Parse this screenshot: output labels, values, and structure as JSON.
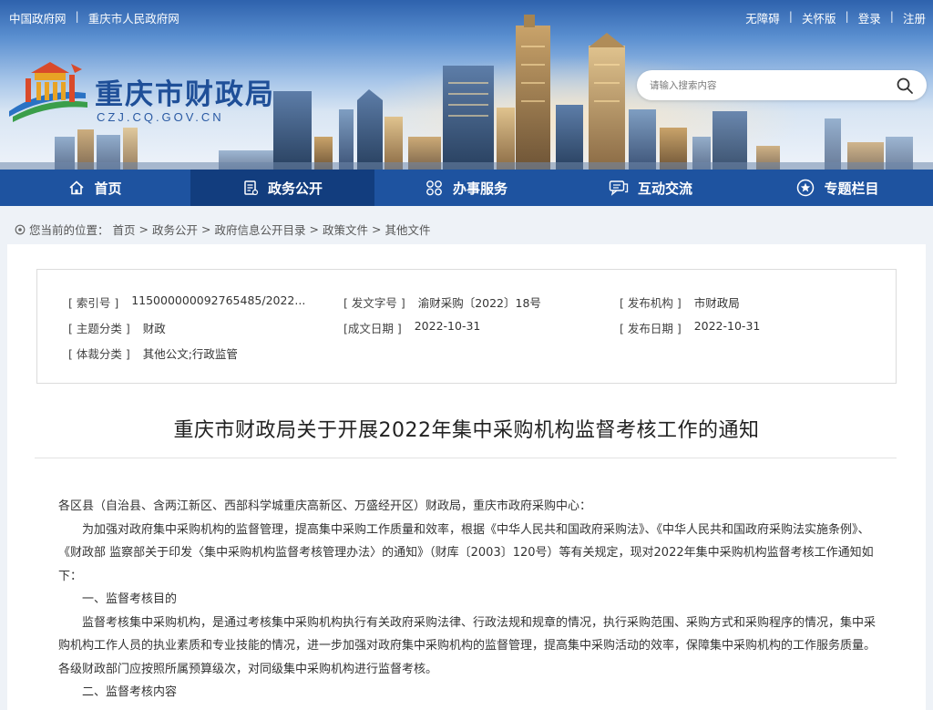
{
  "topbar": {
    "left_links": [
      "中国政府网",
      "重庆市人民政府网"
    ],
    "right_links": [
      "无障碍",
      "关怀版",
      "登录",
      "注册"
    ]
  },
  "brand": {
    "name": "重庆市财政局",
    "domain": "CZJ.CQ.GOV.CN"
  },
  "search": {
    "placeholder": "请输入搜索内容"
  },
  "nav": {
    "items": [
      {
        "label": "首页",
        "icon": "home-icon"
      },
      {
        "label": "政务公开",
        "icon": "document-icon"
      },
      {
        "label": "办事服务",
        "icon": "services-icon"
      },
      {
        "label": "互动交流",
        "icon": "chat-icon"
      },
      {
        "label": "专题栏目",
        "icon": "star-icon"
      }
    ],
    "active_index": 1
  },
  "breadcrumb": {
    "prefix": "您当前的位置：",
    "items": [
      "首页",
      "政务公开",
      "政府信息公开目录",
      "政策文件",
      "其他文件"
    ]
  },
  "meta": {
    "index_no_label": "[ 索引号 ]",
    "index_no": "115000000092765485/2022...",
    "doc_no_label": "[ 发文字号 ]",
    "doc_no": "渝财采购〔2022〕18号",
    "publisher_label": "[ 发布机构 ]",
    "publisher": "市财政局",
    "topic_label": "[ 主题分类 ]",
    "topic": "财政",
    "created_label": "[成文日期 ]",
    "created": "2022-10-31",
    "published_label": "[ 发布日期 ]",
    "published": "2022-10-31",
    "genre_label": "[ 体裁分类 ]",
    "genre": "其他公文;行政监管"
  },
  "article": {
    "title": "重庆市财政局关于开展2022年集中采购机构监督考核工作的通知",
    "paragraphs": [
      "各区县（自治县、含两江新区、西部科学城重庆高新区、万盛经开区）财政局，重庆市政府采购中心：",
      "为加强对政府集中采购机构的监督管理，提高集中采购工作质量和效率，根据《中华人民共和国政府采购法》、《中华人民共和国政府采购法实施条例》、《财政部 监察部关于印发〈集中采购机构监督考核管理办法〉的通知》（财库〔2003〕120号）等有关规定，现对2022年集中采购机构监督考核工作通知如下：",
      "一、监督考核目的",
      "监督考核集中采购机构，是通过考核集中采购机构执行有关政府采购法律、行政法规和规章的情况，执行采购范围、采购方式和采购程序的情况，集中采购机构工作人员的执业素质和专业技能的情况，进一步加强对政府集中采购机构的监督管理，提高集中采购活动的效率，保障集中采购机构的工作服务质量。各级财政部门应按照所属预算级次，对同级集中采购机构进行监督考核。",
      "二、监督考核内容"
    ]
  },
  "colors": {
    "nav_bg": "#1e53a0",
    "nav_active": "#123d7e",
    "brand": "#1f4f98"
  }
}
